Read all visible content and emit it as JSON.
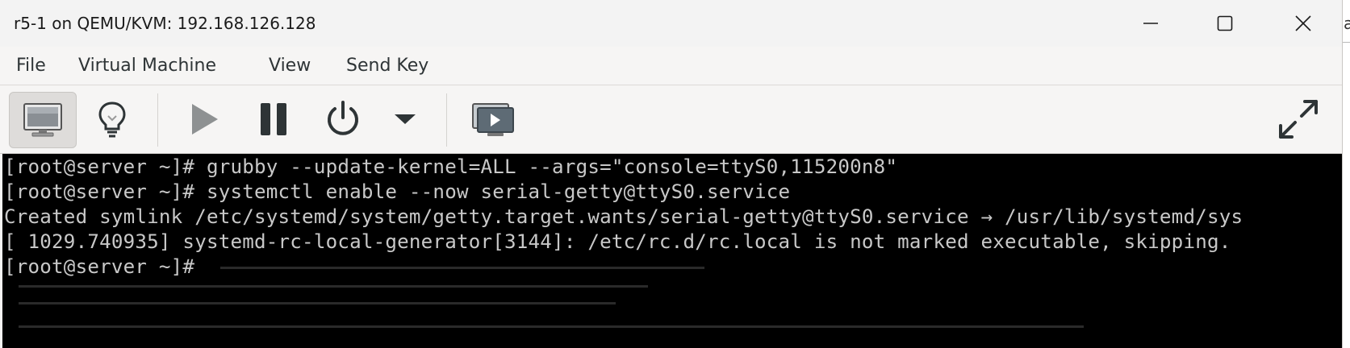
{
  "window": {
    "title": "r5-1 on QEMU/KVM: 192.168.126.128"
  },
  "window_controls": {
    "minimize_icon": "minimize-icon",
    "maximize_icon": "maximize-icon",
    "close_icon": "close-icon"
  },
  "menu": {
    "items": [
      "File",
      "Virtual Machine",
      "View",
      "Send Key"
    ]
  },
  "toolbar": {
    "buttons": [
      {
        "name": "console-view",
        "icon": "monitor-icon",
        "active": true
      },
      {
        "name": "details-view",
        "icon": "lightbulb-icon",
        "active": false
      },
      {
        "name": "run",
        "icon": "play-icon",
        "active": false
      },
      {
        "name": "pause",
        "icon": "pause-icon",
        "active": false
      },
      {
        "name": "shutdown",
        "icon": "power-icon",
        "active": false
      },
      {
        "name": "shutdown-menu",
        "icon": "chevron-down-icon",
        "active": false
      },
      {
        "name": "snapshots",
        "icon": "snapshot-icon",
        "active": false
      },
      {
        "name": "fullscreen",
        "icon": "fullscreen-icon",
        "active": false
      }
    ]
  },
  "console": {
    "lines": [
      "[root@server ~]# grubby --update-kernel=ALL --args=\"console=ttyS0,115200n8\"",
      "[root@server ~]# systemctl enable --now serial-getty@ttyS0.service",
      "Created symlink /etc/systemd/system/getty.target.wants/serial-getty@ttyS0.service → /usr/lib/systemd/sys",
      "[ 1029.740935] systemd-rc-local-generator[3144]: /etc/rc.d/rc.local is not marked executable, skipping.",
      "[root@server ~]#"
    ]
  },
  "colors": {
    "console_bg": "#000000",
    "console_fg": "#c8c8c8",
    "window_bg": "#f6f5f4",
    "icon_dark": "#2e3436",
    "icon_disabled": "#8e9192"
  },
  "desktop": {
    "peek_char": "a"
  }
}
